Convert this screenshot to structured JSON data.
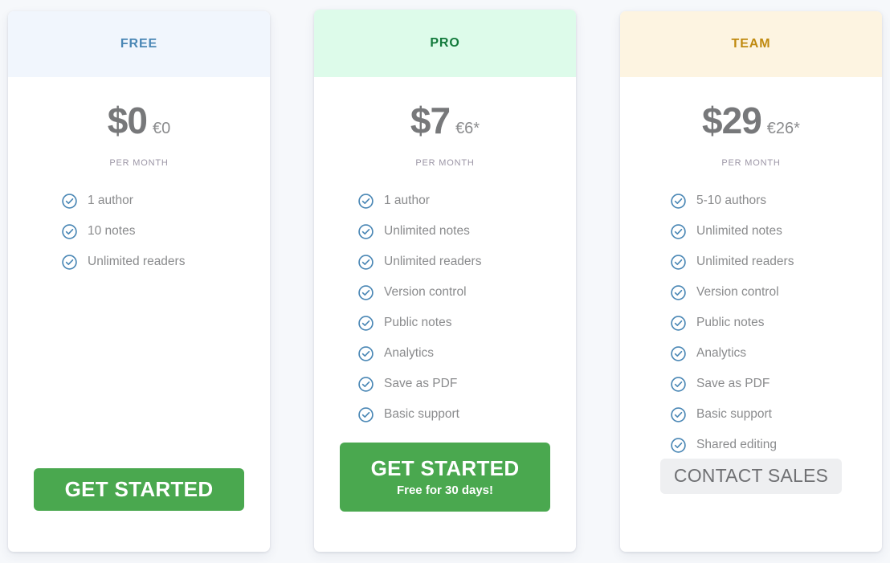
{
  "page": {
    "background_color": "#f6f8fb"
  },
  "plans": [
    {
      "id": "free",
      "name": "FREE",
      "header_bg": "#f1f6fd",
      "header_color": "#4a87b5",
      "price_main": "$0",
      "price_alt": "€0",
      "period": "PER MONTH",
      "features": [
        "1 author",
        "10 notes",
        "Unlimited readers"
      ],
      "cta": {
        "label": "GET STARTED",
        "sublabel": "",
        "style": "green",
        "color": "#4aa84f"
      }
    },
    {
      "id": "pro",
      "name": "PRO",
      "header_bg": "#ddfbea",
      "header_color": "#137a3c",
      "price_main": "$7",
      "price_alt": "€6*",
      "period": "PER MONTH",
      "features": [
        "1 author",
        "Unlimited notes",
        "Unlimited readers",
        "Version control",
        "Public notes",
        "Analytics",
        "Save as PDF",
        "Basic support"
      ],
      "cta": {
        "label": "GET STARTED",
        "sublabel": "Free for 30 days!",
        "style": "green",
        "color": "#4aa84f"
      }
    },
    {
      "id": "team",
      "name": "TEAM",
      "header_bg": "#fdf4e1",
      "header_color": "#c08a10",
      "price_main": "$29",
      "price_alt": "€26*",
      "period": "PER MONTH",
      "features": [
        "5-10 authors",
        "Unlimited notes",
        "Unlimited readers",
        "Version control",
        "Public notes",
        "Analytics",
        "Save as PDF",
        "Basic support",
        "Shared editing"
      ],
      "cta": {
        "label": "CONTACT SALES",
        "sublabel": "",
        "style": "grey",
        "color": "#eeeff1"
      }
    }
  ],
  "icons": {
    "check": "check-circle-icon",
    "check_color": "#4a87b5"
  }
}
